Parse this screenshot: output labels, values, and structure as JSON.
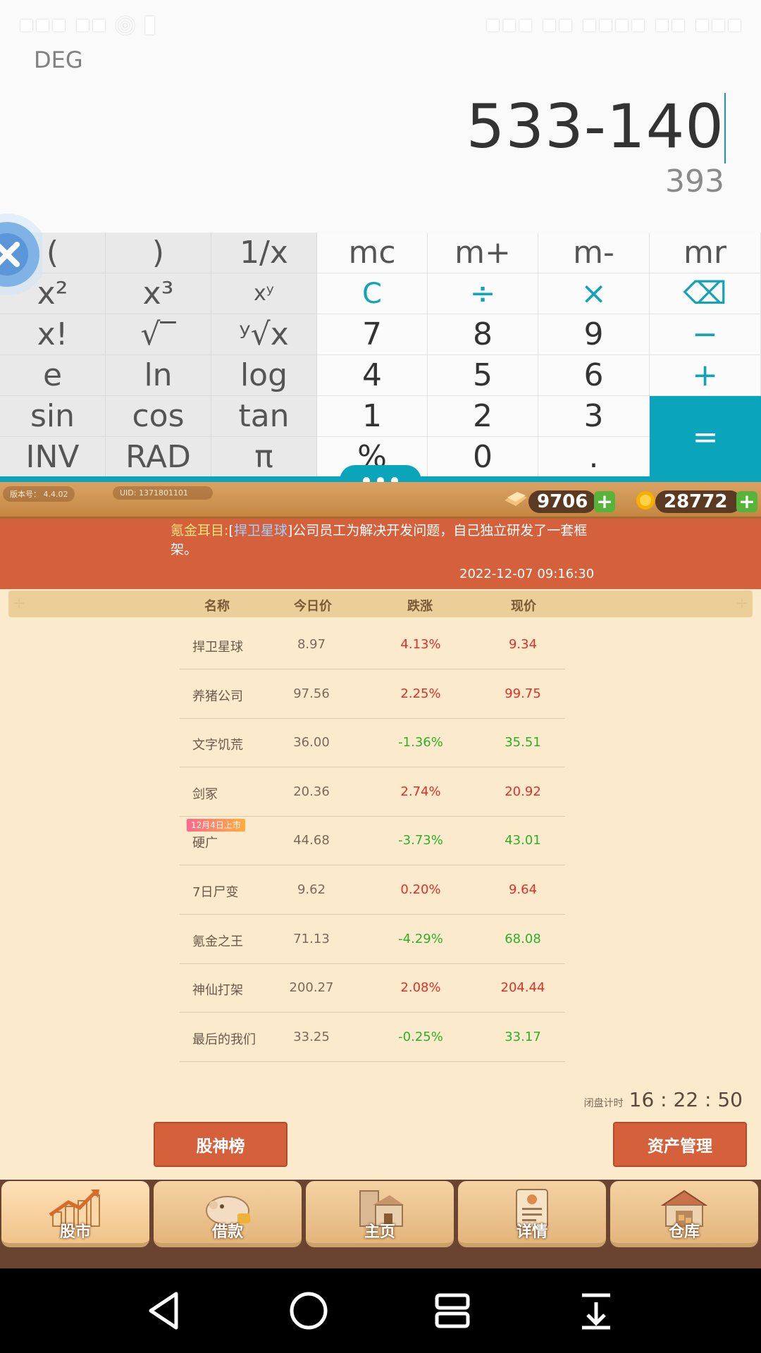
{
  "calculator": {
    "mode": "DEG",
    "expression": "533-140",
    "result": "393",
    "keys": [
      [
        "(",
        ")",
        "1/x",
        "mc",
        "m+",
        "m-",
        "mr"
      ],
      [
        "x²",
        "x³",
        "xʸ",
        "C",
        "÷",
        "×",
        "⌫"
      ],
      [
        "x!",
        "√‾",
        "ʸ√x",
        "7",
        "8",
        "9",
        "−"
      ],
      [
        "e",
        "ln",
        "log",
        "4",
        "5",
        "6",
        "+"
      ],
      [
        "sin",
        "cos",
        "tan",
        "1",
        "2",
        "3",
        "="
      ],
      [
        "INV",
        "RAD",
        "π",
        "%",
        "0",
        ".",
        ""
      ]
    ]
  },
  "game": {
    "version_label": "版本号： 4.4.02",
    "uid_label": "UID: 1371801101",
    "resources": [
      {
        "icon": "gold-bar-icon",
        "value": "9706"
      },
      {
        "icon": "coin-icon",
        "value": "28772"
      }
    ],
    "news": {
      "source": "氪金耳目:",
      "bracket_open": "[",
      "company": "捍卫星球",
      "bracket_close": "]",
      "text": "公司员工为解决开发问题，自己独立研发了一套框架。",
      "time": "2022-12-07 09:16:30"
    },
    "table": {
      "headers": [
        "名称",
        "今日价",
        "跌涨",
        "现价"
      ],
      "rows": [
        {
          "name": "捍卫星球",
          "today": "8.97",
          "change": "4.13%",
          "now": "9.34",
          "trend": "up"
        },
        {
          "name": "养猪公司",
          "today": "97.56",
          "change": "2.25%",
          "now": "99.75",
          "trend": "up"
        },
        {
          "name": "文字饥荒",
          "today": "36.00",
          "change": "-1.36%",
          "now": "35.51",
          "trend": "down"
        },
        {
          "name": "剑冢",
          "today": "20.36",
          "change": "2.74%",
          "now": "20.92",
          "trend": "up"
        },
        {
          "name": "硬广",
          "today": "44.68",
          "change": "-3.73%",
          "now": "43.01",
          "trend": "down",
          "tag": "12月4日上市"
        },
        {
          "name": "7日尸变",
          "today": "9.62",
          "change": "0.20%",
          "now": "9.64",
          "trend": "up"
        },
        {
          "name": "氪金之王",
          "today": "71.13",
          "change": "-4.29%",
          "now": "68.08",
          "trend": "down"
        },
        {
          "name": "神仙打架",
          "today": "200.27",
          "change": "2.08%",
          "now": "204.44",
          "trend": "up"
        },
        {
          "name": "最后的我们",
          "today": "33.25",
          "change": "-0.25%",
          "now": "33.17",
          "trend": "down"
        }
      ]
    },
    "timer": {
      "label": "闭盘计时",
      "value": "16 : 22 : 50"
    },
    "buttons": {
      "leaderboard": "股神榜",
      "assets": "资产管理"
    },
    "tabs": [
      {
        "label": "股市",
        "icon": "stock-chart-icon",
        "active": true
      },
      {
        "label": "借款",
        "icon": "piggy-bank-icon",
        "active": false
      },
      {
        "label": "主页",
        "icon": "house-icon",
        "active": false
      },
      {
        "label": "详情",
        "icon": "profile-card-icon",
        "active": false
      },
      {
        "label": "仓库",
        "icon": "warehouse-icon",
        "active": false
      }
    ],
    "colors": {
      "up": "#e0302a",
      "down": "#2fae2a",
      "accent": "#d5603c"
    }
  },
  "navbar": {
    "buttons": [
      "back-icon",
      "home-icon",
      "recents-icon",
      "notification-pull-icon"
    ]
  }
}
